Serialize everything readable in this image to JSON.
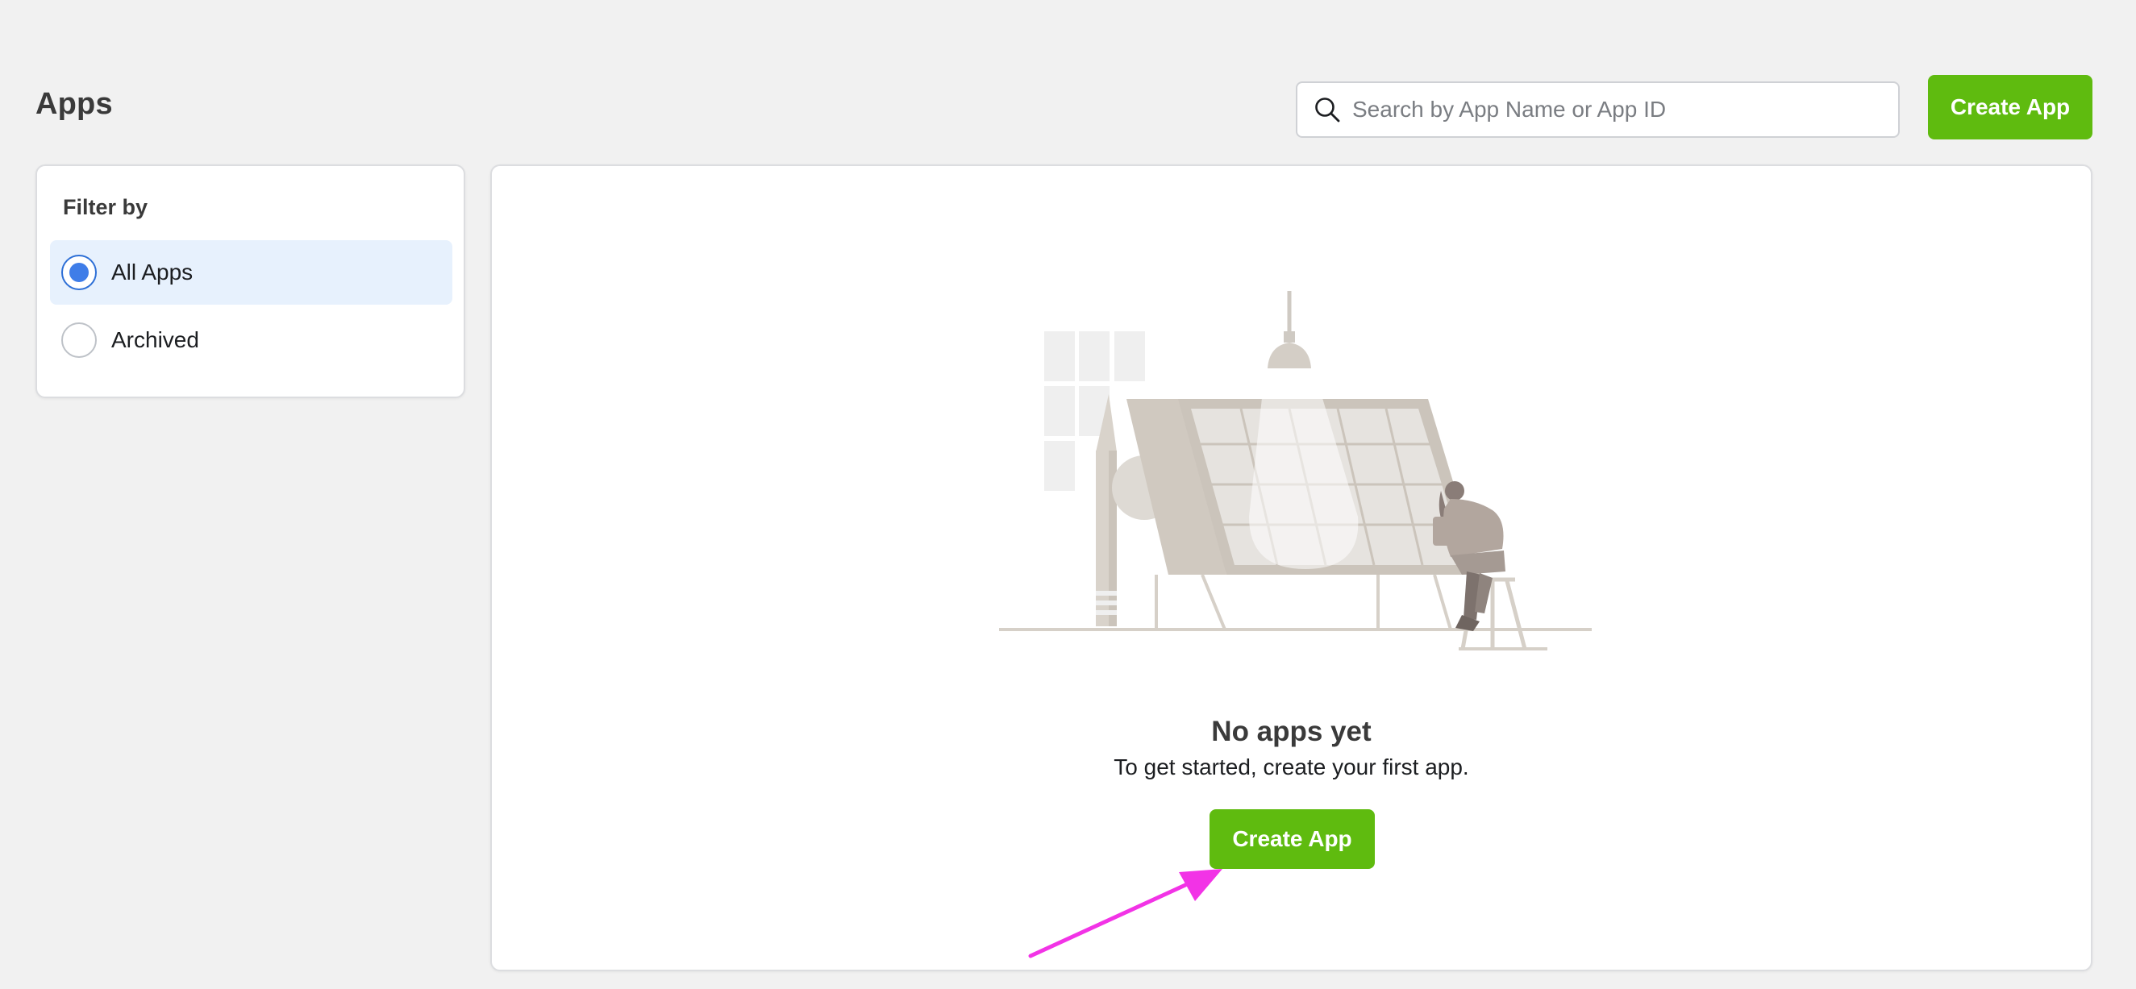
{
  "page": {
    "title": "Apps"
  },
  "search": {
    "placeholder": "Search by App Name or App ID",
    "value": "",
    "icon": "search-icon"
  },
  "header": {
    "create_app_label": "Create App"
  },
  "filter": {
    "title": "Filter by",
    "options": [
      {
        "label": "All Apps",
        "selected": true
      },
      {
        "label": "Archived",
        "selected": false
      }
    ]
  },
  "empty_state": {
    "title": "No apps yet",
    "subtitle": "To get started, create your first app.",
    "button_label": "Create App"
  },
  "colors": {
    "background": "#f1f1f1",
    "primary_green": "#5fbb0f",
    "selected_bg": "#e7f1fd",
    "radio_blue": "#3f7de8",
    "annotation_arrow": "#f233e6",
    "illustration_tone": "#d6d0c8"
  }
}
